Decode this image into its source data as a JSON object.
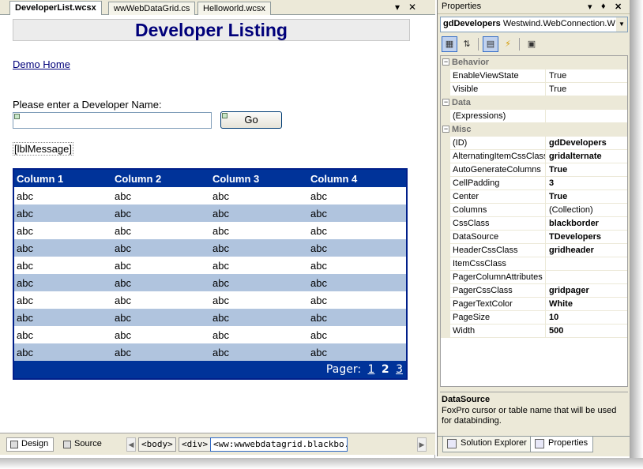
{
  "designer": {
    "tabs": [
      {
        "label": "DeveloperList.wcsx",
        "active": true
      },
      {
        "label": "wwWebDataGrid.cs",
        "active": false
      },
      {
        "label": "Helloworld.wcsx",
        "active": false
      }
    ],
    "controls": {
      "dropdown_icon": "chevron-down-icon",
      "close_icon": "close-icon"
    }
  },
  "page": {
    "title": "Developer Listing",
    "demo_link": "Demo Home",
    "prompt": "Please enter a Developer Name:",
    "name_input_value": "",
    "go_button": "Go",
    "message_label": "[lblMessage]"
  },
  "datagrid": {
    "columns": [
      "Column 1",
      "Column 2",
      "Column 3",
      "Column 4"
    ],
    "rows": [
      [
        "abc",
        "abc",
        "abc",
        "abc"
      ],
      [
        "abc",
        "abc",
        "abc",
        "abc"
      ],
      [
        "abc",
        "abc",
        "abc",
        "abc"
      ],
      [
        "abc",
        "abc",
        "abc",
        "abc"
      ],
      [
        "abc",
        "abc",
        "abc",
        "abc"
      ],
      [
        "abc",
        "abc",
        "abc",
        "abc"
      ],
      [
        "abc",
        "abc",
        "abc",
        "abc"
      ],
      [
        "abc",
        "abc",
        "abc",
        "abc"
      ],
      [
        "abc",
        "abc",
        "abc",
        "abc"
      ],
      [
        "abc",
        "abc",
        "abc",
        "abc"
      ]
    ],
    "pager_label": "Pager:",
    "pages": [
      "1",
      "2",
      "3"
    ],
    "current_page": "2",
    "header_color": "#003399",
    "alt_row_color": "#b0c4de"
  },
  "bottom_bar": {
    "design_label": "Design",
    "source_label": "Source",
    "breadcrumbs": [
      "<body>",
      "<div>",
      "<ww:wwwebdatagrid.blackbo...>"
    ]
  },
  "properties": {
    "title": "Properties",
    "object_name": "gdDevelopers",
    "object_type": "Westwind.WebConnection.W",
    "categories": [
      {
        "name": "Behavior",
        "items": [
          {
            "name": "EnableViewState",
            "value": "True",
            "bold": false
          },
          {
            "name": "Visible",
            "value": "True",
            "bold": false
          }
        ]
      },
      {
        "name": "Data",
        "items": [
          {
            "name": "(Expressions)",
            "value": "",
            "bold": false
          }
        ]
      },
      {
        "name": "Misc",
        "items": [
          {
            "name": "(ID)",
            "value": "gdDevelopers",
            "bold": true
          },
          {
            "name": "AlternatingItemCssClass",
            "value": "gridalternate",
            "bold": true
          },
          {
            "name": "AutoGenerateColumns",
            "value": "True",
            "bold": true
          },
          {
            "name": "CellPadding",
            "value": "3",
            "bold": true
          },
          {
            "name": "Center",
            "value": "True",
            "bold": true
          },
          {
            "name": "Columns",
            "value": "(Collection)",
            "bold": false
          },
          {
            "name": "CssClass",
            "value": "blackborder",
            "bold": true
          },
          {
            "name": "DataSource",
            "value": "TDevelopers",
            "bold": true
          },
          {
            "name": "HeaderCssClass",
            "value": "gridheader",
            "bold": true
          },
          {
            "name": "ItemCssClass",
            "value": "",
            "bold": false
          },
          {
            "name": "PagerColumnAttributes",
            "value": "",
            "bold": false
          },
          {
            "name": "PagerCssClass",
            "value": "gridpager",
            "bold": true
          },
          {
            "name": "PagerTextColor",
            "value": "White",
            "bold": true
          },
          {
            "name": "PageSize",
            "value": "10",
            "bold": true
          },
          {
            "name": "Width",
            "value": "500",
            "bold": true
          }
        ]
      }
    ],
    "description_title": "DataSource",
    "description_text": "FoxPro cursor or table name that will be used for databinding.",
    "bottom_tabs": [
      {
        "label": "Solution Explorer",
        "active": false
      },
      {
        "label": "Properties",
        "active": true
      }
    ]
  }
}
